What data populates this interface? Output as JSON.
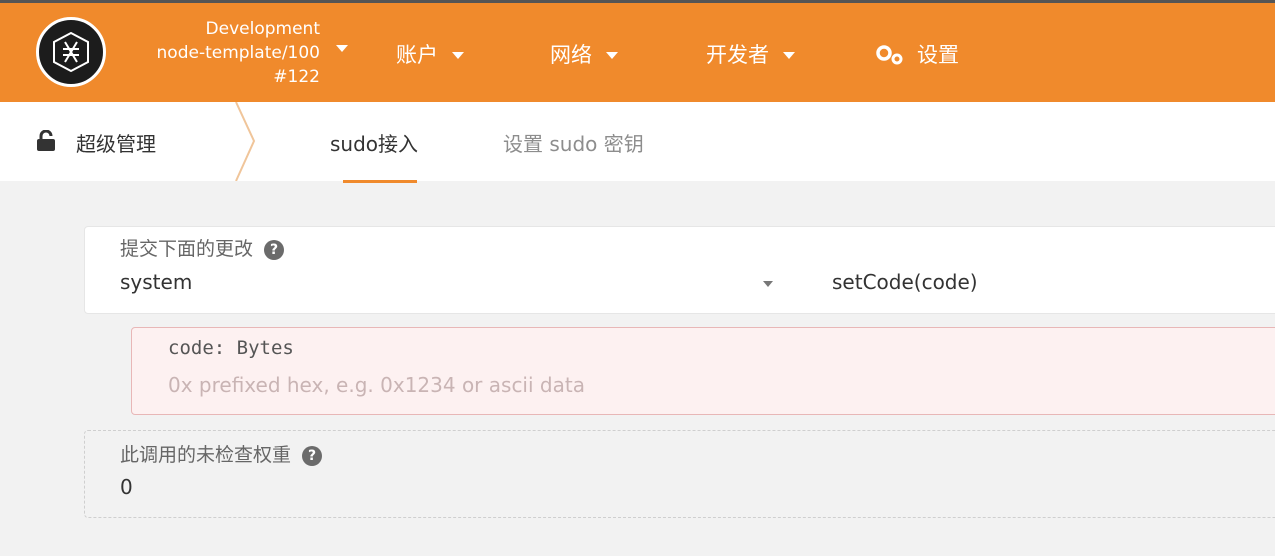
{
  "header": {
    "chain_name": "Development",
    "runtime": "node-template/100",
    "block": "#122",
    "menu": [
      {
        "label": "账户"
      },
      {
        "label": "网络"
      },
      {
        "label": "开发者"
      }
    ],
    "settings_label": "设置",
    "accent_color": "#f08a2c"
  },
  "subnav": {
    "section": "超级管理",
    "tabs": [
      {
        "label": "sudo接入",
        "active": true
      },
      {
        "label": "设置 sudo 密钥",
        "active": false
      }
    ]
  },
  "form": {
    "submit_label": "提交下面的更改",
    "section_value": "system",
    "method_value": "setCode(code)",
    "code_param_label": "code: Bytes",
    "code_placeholder": "0x prefixed hex, e.g. 0x1234 or ascii data",
    "weight_label": "此调用的未检查权重",
    "weight_value": "0"
  }
}
